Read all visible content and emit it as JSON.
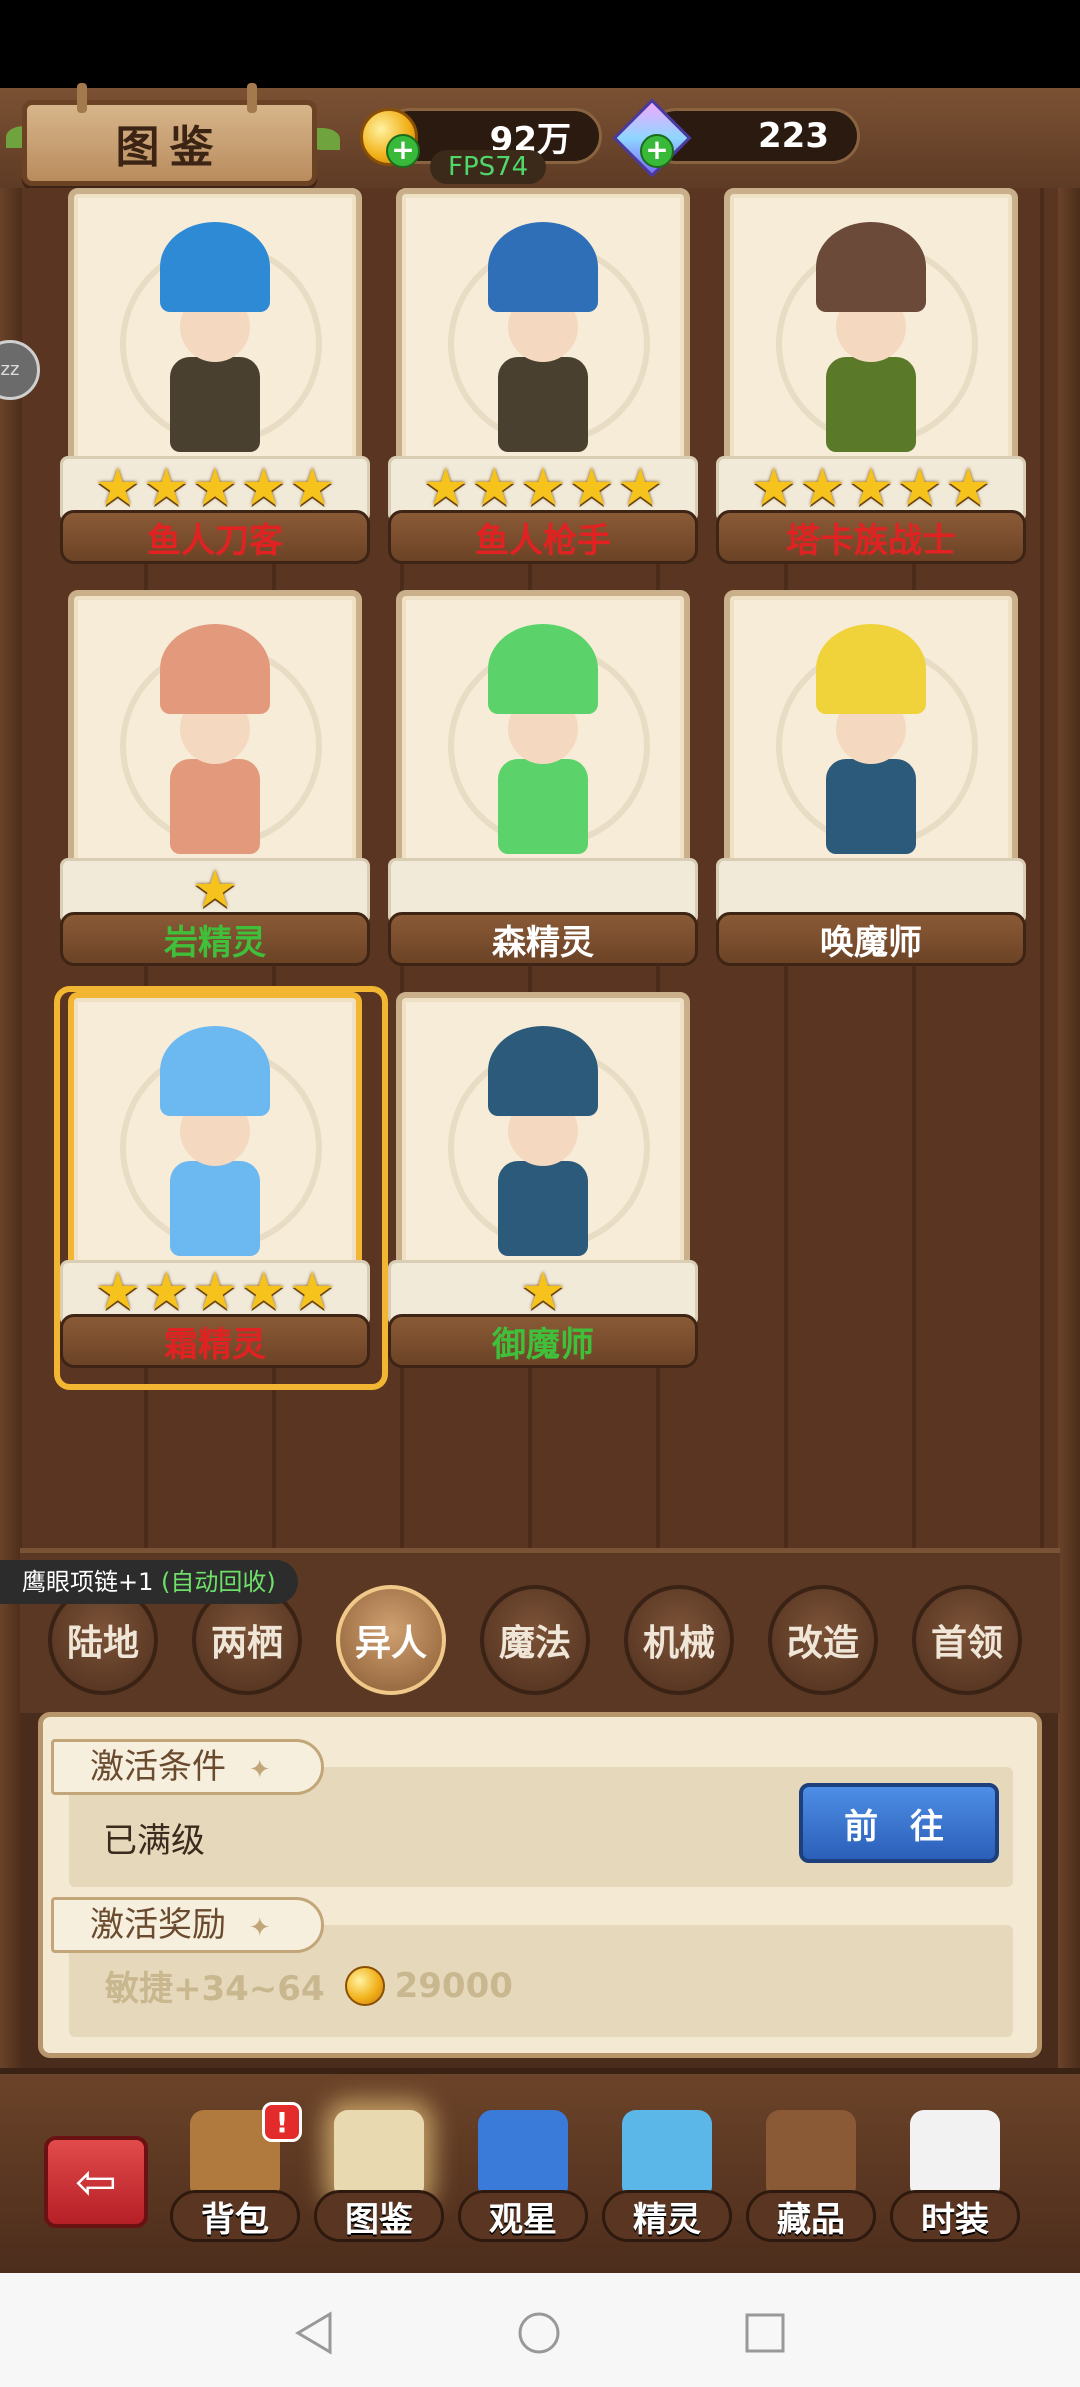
{
  "header": {
    "title": "图鉴",
    "gold": "92万",
    "gems": "223",
    "fps": "FPS74"
  },
  "side_button_text": "zz",
  "cards": [
    {
      "name": "鱼人刀客",
      "stars": 5,
      "name_color": "#e12222",
      "hat": "#2f8ad6",
      "body": "#4a4030"
    },
    {
      "name": "鱼人枪手",
      "stars": 5,
      "name_color": "#e12222",
      "hat": "#2f6fb8",
      "body": "#4a4030"
    },
    {
      "name": "塔卡族战士",
      "stars": 5,
      "name_color": "#e12222",
      "hat": "#6b4a3a",
      "body": "#5a7a2a"
    },
    {
      "name": "岩精灵",
      "stars": 1,
      "name_color": "#3fbf3a",
      "hat": "#e39a7c",
      "body": "#e39a7c"
    },
    {
      "name": "森精灵",
      "stars": 0,
      "name_color": "#ffffff",
      "hat": "#5bd36a",
      "body": "#5bd36a"
    },
    {
      "name": "唤魔师",
      "stars": 0,
      "name_color": "#ffffff",
      "hat": "#f0d23a",
      "body": "#2c5a7a"
    },
    {
      "name": "霜精灵",
      "stars": 5,
      "name_color": "#e12222",
      "hat": "#6cb8f0",
      "body": "#6cb8f0",
      "selected": true
    },
    {
      "name": "御魔师",
      "stars": 1,
      "name_color": "#3fbf3a",
      "hat": "#2c5a7a",
      "body": "#2c5a7a"
    }
  ],
  "toast": {
    "prefix": "鹰眼项链+1",
    "suffix": "(自动回收)"
  },
  "tabs": [
    {
      "label": "陆地",
      "active": false
    },
    {
      "label": "两栖",
      "active": false
    },
    {
      "label": "异人",
      "active": true
    },
    {
      "label": "魔法",
      "active": false
    },
    {
      "label": "机械",
      "active": false
    },
    {
      "label": "改造",
      "active": false
    },
    {
      "label": "首领",
      "active": false
    }
  ],
  "panel": {
    "condition_title": "激活条件",
    "condition_text": "已满级",
    "goto_label": "前 往",
    "reward_title": "激活奖励",
    "reward_text": "敏捷+34~64",
    "reward_coins": "29000"
  },
  "bottom_nav": [
    {
      "label": "背包",
      "icon": "backpack-icon",
      "color": "#b07a3e",
      "badge": "!"
    },
    {
      "label": "图鉴",
      "icon": "book-icon",
      "color": "#e8d9b0",
      "active": true
    },
    {
      "label": "观星",
      "icon": "star-compass-icon",
      "color": "#3a7ad9"
    },
    {
      "label": "精灵",
      "icon": "spirit-icon",
      "color": "#5ab7e8"
    },
    {
      "label": "藏品",
      "icon": "treasure-chest-icon",
      "color": "#8a5a36"
    },
    {
      "label": "时装",
      "icon": "costume-icon",
      "color": "#f2f2f2"
    }
  ]
}
